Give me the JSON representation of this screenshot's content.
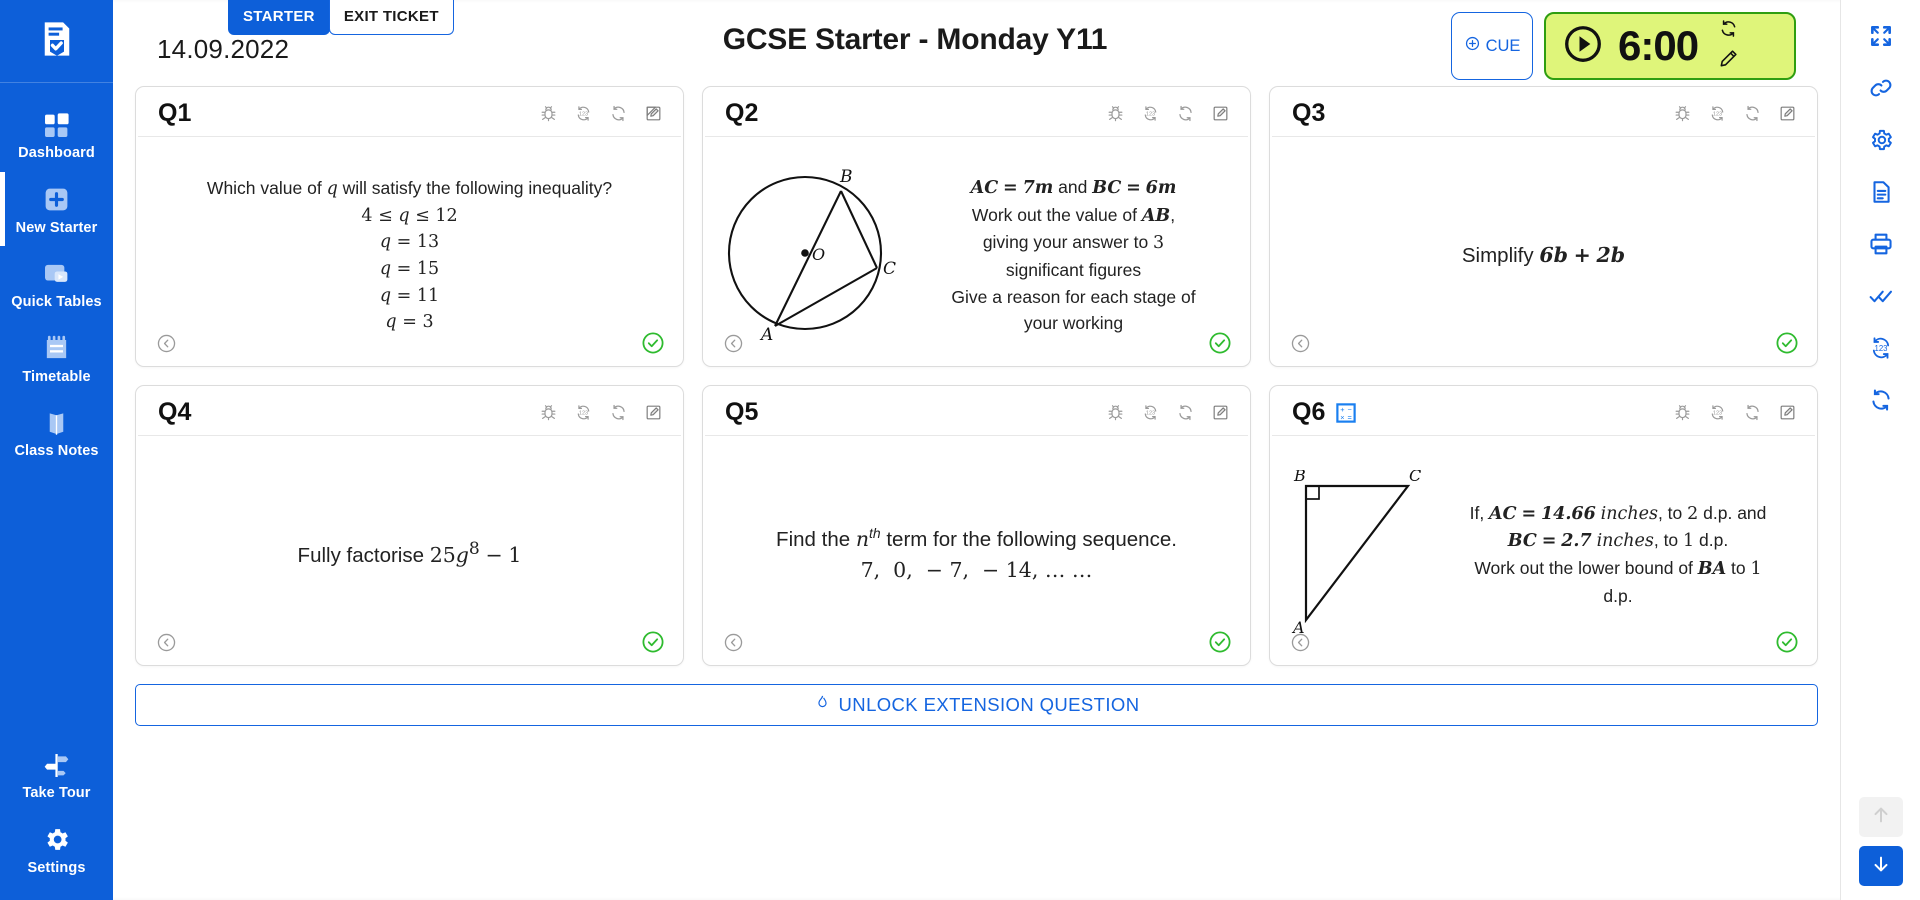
{
  "brand": {
    "primary": "#0d5fd9",
    "accent_blue": "#1565e0",
    "timer_bg": "#dff57a",
    "timer_border": "#2f9e11",
    "tick_green": "#2fbb2f"
  },
  "sidebar": {
    "logo_icon": "document-check-icon",
    "items": [
      {
        "label": "Dashboard",
        "icon": "grid-icon",
        "active": false
      },
      {
        "label": "New Starter",
        "icon": "plus-square-icon",
        "active": true
      },
      {
        "label": "Quick Tables",
        "icon": "table-play-icon",
        "active": false
      },
      {
        "label": "Timetable",
        "icon": "calendar-icon",
        "active": false
      },
      {
        "label": "Class Notes",
        "icon": "notebook-icon",
        "active": false
      }
    ],
    "bottom_items": [
      {
        "label": "Take Tour",
        "icon": "signpost-icon"
      },
      {
        "label": "Settings",
        "icon": "gear-icon"
      }
    ]
  },
  "tabs": [
    {
      "label": "STARTER",
      "active": true
    },
    {
      "label": "EXIT TICKET",
      "active": false
    }
  ],
  "header": {
    "date": "14.09.2022",
    "title": "GCSE Starter - Monday Y11",
    "cue_label": "CUE",
    "cue_icon": "plus-circle-icon",
    "timer": {
      "value": "6:00",
      "play_icon": "play-circle-icon",
      "reset_icon": "refresh-icon",
      "edit_icon": "pencil-icon"
    }
  },
  "card_tools": [
    {
      "icon": "bug-icon",
      "name": "report-bug"
    },
    {
      "icon": "numbers-refresh-icon",
      "name": "new-numbers"
    },
    {
      "icon": "refresh-icon",
      "name": "new-question"
    },
    {
      "icon": "edit-square-icon",
      "name": "edit-question"
    }
  ],
  "card_footer": {
    "prev_icon": "chevron-left-circle-icon",
    "tick_icon": "check-circle-icon"
  },
  "questions": [
    {
      "title": "Q1",
      "badge": null,
      "layout": "text",
      "lines": [
        {
          "kind": "prose",
          "html": "Which value of <span class=\"mi\">q</span> will satisfy the following inequality?"
        },
        {
          "kind": "math",
          "html": "<span class=\"mn\">4</span> <span class=\"mn\">≤</span> <span class=\"mi\">q</span> <span class=\"mn\">≤</span> <span class=\"mn\">12</span>"
        },
        {
          "kind": "math",
          "html": "<span class=\"mi\">q</span> <span class=\"mn\">=</span> <span class=\"mn\">13</span>"
        },
        {
          "kind": "math",
          "html": "<span class=\"mi\">q</span> <span class=\"mn\">=</span> <span class=\"mn\">15</span>"
        },
        {
          "kind": "math",
          "html": "<span class=\"mi\">q</span> <span class=\"mn\">=</span> <span class=\"mn\">11</span>"
        },
        {
          "kind": "math",
          "html": "<span class=\"mi\">q</span> <span class=\"mn\">=</span> <span class=\"mn\">3</span>"
        }
      ],
      "plain_text": "Which value of q will satisfy the following inequality? 4 ≤ q ≤ 12 ; q = 13 ; q = 15 ; q = 11 ; q = 3"
    },
    {
      "title": "Q2",
      "badge": null,
      "layout": "diagram-right-text",
      "diagram": "circle-theorem-ABCO",
      "diagram_labels": [
        "A",
        "B",
        "C",
        "O"
      ],
      "lines": [
        {
          "kind": "prose",
          "html": "<span class=\"mb\">AC</span> <span class=\"mb\">=</span> <span class=\"mb\">7m</span> and <span class=\"mb\">BC</span> <span class=\"mb\">=</span> <span class=\"mb\">6m</span>"
        },
        {
          "kind": "prose",
          "html": "Work out the value of <span class=\"mb\">AB</span>,"
        },
        {
          "kind": "prose",
          "html": "giving your answer to <span class=\"mn\">3</span>"
        },
        {
          "kind": "prose",
          "html": "significant figures"
        },
        {
          "kind": "prose",
          "html": "Give a reason for each stage of"
        },
        {
          "kind": "prose",
          "html": "your working"
        }
      ],
      "plain_text": "AC = 7m and BC = 6m. Work out the value of AB, giving your answer to 3 significant figures. Give a reason for each stage of your working"
    },
    {
      "title": "Q3",
      "badge": null,
      "layout": "text",
      "lines": [
        {
          "kind": "prose",
          "html": "<span class=\"big\">Simplify <span class=\"mb\">6b</span> <span class=\"mb\">+</span> <span class=\"mb\">2b</span></span>"
        }
      ],
      "plain_text": "Simplify 6b + 2b"
    },
    {
      "title": "Q4",
      "badge": null,
      "layout": "text",
      "lines": [
        {
          "kind": "prose",
          "html": "<span class=\"big\">Fully factorise <span class=\"mn\">25</span><span class=\"mi\">g</span><sup class=\"mn\" style=\"font-style:normal\">8</sup> <span class=\"mn\">−</span> <span class=\"mn\">1</span></span>"
        }
      ],
      "plain_text": "Fully factorise 25g^8 − 1"
    },
    {
      "title": "Q5",
      "badge": null,
      "layout": "text",
      "lines": [
        {
          "kind": "prose",
          "html": "<span class=\"big\">Find the <span class=\"mi\">n</span><sup class=\"th\">th</sup> term for the following sequence.</span>"
        },
        {
          "kind": "math",
          "html": "<span class=\"big mn\">7,&nbsp; 0,&nbsp; − 7,&nbsp; − 14, … …</span>"
        }
      ],
      "plain_text": "Find the nth term for the following sequence. 7, 0, − 7, − 14, … …"
    },
    {
      "title": "Q6",
      "badge": "calculator-icon",
      "layout": "diagram-right-text",
      "diagram": "right-triangle-ABC",
      "diagram_labels": [
        "A",
        "B",
        "C"
      ],
      "lines": [
        {
          "kind": "prose",
          "html": "If, <span class=\"mb\">AC</span> <span class=\"mb\">=</span> <span class=\"mb\">14.66</span> <span class=\"mi\">inches</span>, to <span class=\"mn\">2</span> d.p. and"
        },
        {
          "kind": "prose",
          "html": "<span class=\"mb\">BC</span> <span class=\"mb\">=</span> <span class=\"mb\">2.7</span> <span class=\"mi\">inches</span>, to <span class=\"mn\">1</span> d.p."
        },
        {
          "kind": "prose",
          "html": "Work out the lower bound of <span class=\"mb\">BA</span> to <span class=\"mn\">1</span>"
        },
        {
          "kind": "prose",
          "html": "d.p."
        }
      ],
      "plain_text": "If, AC = 14.66 inches, to 2 d.p. and BC = 2.7 inches, to 1 d.p. Work out the lower bound of BA to 1 d.p."
    }
  ],
  "unlock": {
    "label": "UNLOCK EXTENSION QUESTION",
    "icon": "flame-icon"
  },
  "rail": {
    "items": [
      {
        "icon": "fullscreen-icon",
        "name": "fullscreen"
      },
      {
        "icon": "link-icon",
        "name": "share-link"
      },
      {
        "icon": "gear-icon",
        "name": "settings"
      },
      {
        "icon": "document-icon",
        "name": "worksheet"
      },
      {
        "icon": "printer-icon",
        "name": "print"
      },
      {
        "icon": "double-check-icon",
        "name": "mark-all"
      },
      {
        "icon": "numbers-refresh-icon",
        "name": "refresh-numbers"
      },
      {
        "icon": "refresh-icon",
        "name": "refresh-all"
      }
    ],
    "arrows": [
      {
        "icon": "arrow-up-icon",
        "name": "scroll-up",
        "enabled": false
      },
      {
        "icon": "arrow-down-icon",
        "name": "scroll-down",
        "enabled": true
      }
    ]
  }
}
